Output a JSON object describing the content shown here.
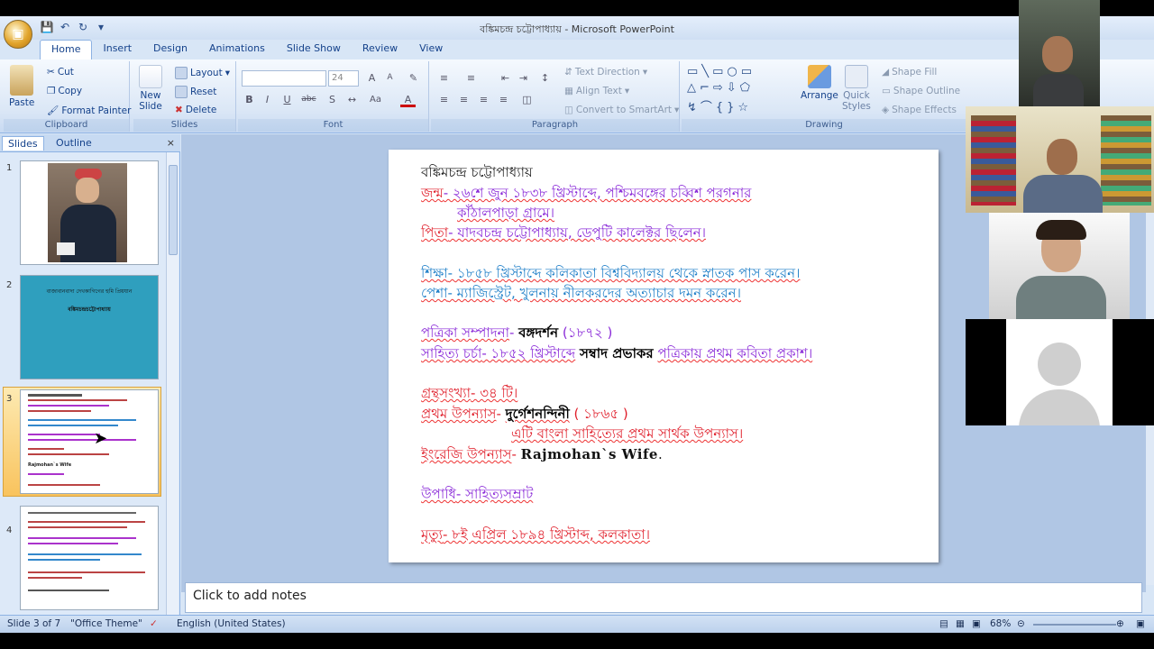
{
  "window": {
    "title": "বঙ্কিমচন্দ্র চট্টোপাধ্যায় - Microsoft PowerPoint"
  },
  "tabs": [
    "Home",
    "Insert",
    "Design",
    "Animations",
    "Slide Show",
    "Review",
    "View"
  ],
  "ribbon": {
    "clipboard": {
      "label": "Clipboard",
      "paste": "Paste",
      "cut": "Cut",
      "copy": "Copy",
      "format_painter": "Format Painter"
    },
    "slides": {
      "label": "Slides",
      "new_slide_1": "New",
      "new_slide_2": "Slide",
      "layout": "Layout",
      "reset": "Reset",
      "delete": "Delete"
    },
    "font": {
      "label": "Font",
      "size": "24"
    },
    "paragraph": {
      "label": "Paragraph",
      "text_direction": "Text Direction",
      "align_text": "Align Text",
      "convert_smartart": "Convert to SmartArt"
    },
    "drawing": {
      "label": "Drawing",
      "arrange": "Arrange",
      "quick_styles_1": "Quick",
      "quick_styles_2": "Styles",
      "shape_fill": "Shape Fill",
      "shape_outline": "Shape Outline",
      "shape_effects": "Shape Effects"
    }
  },
  "panel": {
    "tab_slides": "Slides",
    "tab_outline": "Outline",
    "close": "×"
  },
  "thumbnails": [
    {
      "num": "1"
    },
    {
      "num": "2",
      "line1": "বাজাবানবাদা দেখকাগিগের হুমি প্রিয়যান",
      "line2": "বঙ্কিমচন্দ্রচট্টোপাধ্যায়"
    },
    {
      "num": "3",
      "text_en": "Rajmohan`s Wife"
    },
    {
      "num": "4"
    }
  ],
  "slide": {
    "title": "বঙ্কিমচন্দ্র চট্টোপাধ্যায়",
    "birth_label": "জন্ম",
    "birth_text": "- ২৬শে জুন ১৮৩৮ খ্রিস্টাব্দে, পশ্চিমবঙ্গের চব্বিশ পরগনার",
    "birth_text2": "কাঁঠালপাড়া গ্রামে।",
    "father_label": "পিতা",
    "father_text": "- যাদবচন্দ্র চট্টোপাধ্যায়, ডেপুটি কালেক্টর ছিলেন।",
    "edu_label": "শিক্ষা",
    "edu_text": "- ১৮৫৮ খ্রিস্টাব্দে কলিকাতা বিশ্ববিদ্যালয় থেকে স্নাতক পাস করেন।",
    "job_label": "পেশা",
    "job_text": "- ম্যাজিস্ট্রেট, খুলনায় নীলকরদের অত্যাচার দমন করেন।",
    "mag_label": "পত্রিকা সম্পাদনা",
    "mag_bold": "বঙ্গদর্শন",
    "mag_year": "(১৮৭২ )",
    "lit_label": "সাহিত্য চর্চা",
    "lit_text1": "- ১৮৫২ খ্রিস্টাব্দে",
    "lit_bold": "সম্বাদ প্রভাকর",
    "lit_text2": "পত্রিকায় প্রথম কবিতা প্রকাশ।",
    "books_label": "গ্রন্থসংখ্যা",
    "books_text": "- ৩৪ টি।",
    "novel_label": "প্রথম উপন্যাস",
    "novel_bold": "দুর্গেশনন্দিনী",
    "novel_year": "( ১৮৬৫ )",
    "novel_note": "এটি বাংলা সাহিত্যের প্রথম সার্থক উপন্যাস।",
    "eng_label": "ইংরেজি উপন্যাস",
    "eng_title": "Rajmohan`s Wife",
    "title_label": "উপাধি",
    "title_text": "- সাহিত্যসম্রাট",
    "death_label": "মৃত্যু",
    "death_text": "- ৮ই এপ্রিল ১৮৯৪ খ্রিস্টাব্দ, কলকাতা।"
  },
  "notes": {
    "placeholder": "Click to add notes"
  },
  "status": {
    "slide": "Slide 3 of 7",
    "theme": "\"Office Theme\"",
    "language": "English (United States)",
    "zoom": "68%"
  },
  "colors": {
    "ribbon": "#dbe7f6",
    "accent": "#15428b",
    "red": "#e0202c",
    "purple": "#8a2ad8",
    "teal": "#1f7fc8",
    "selected": "#f9c35d",
    "slide2_bg": "#2f9fbe"
  }
}
